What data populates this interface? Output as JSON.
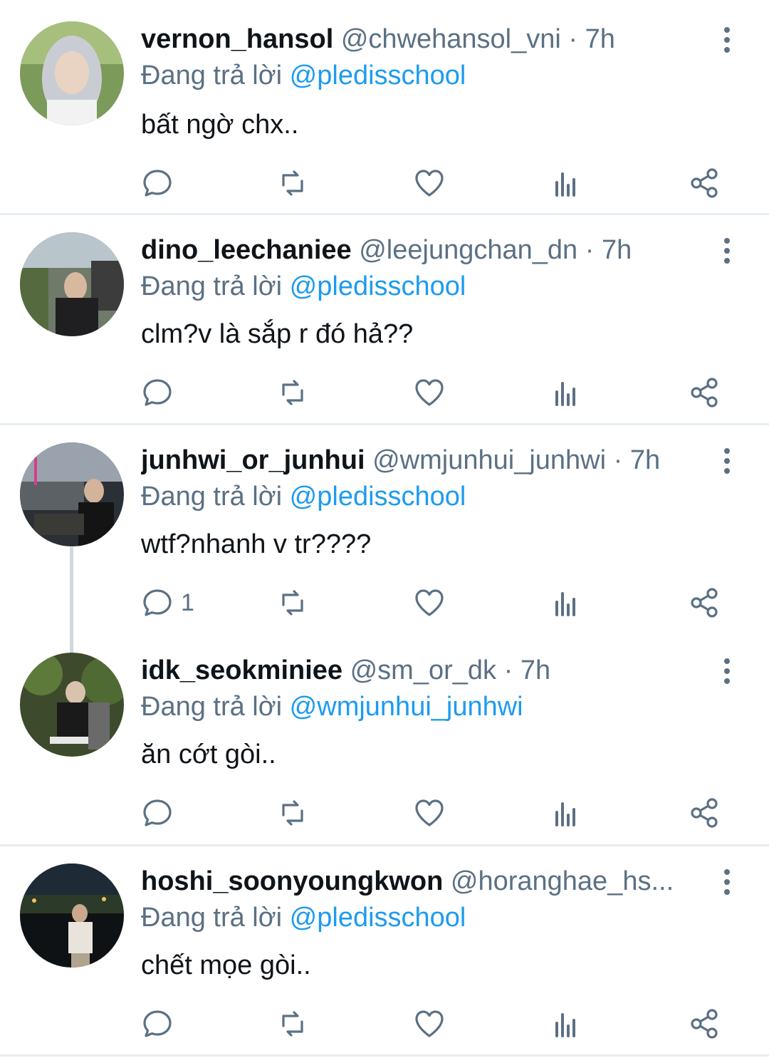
{
  "reply_prefix": "Đang trả lời",
  "colors": {
    "accent": "#1d9bf0",
    "secondary_text": "#5b7083",
    "divider": "#e6ecf0",
    "thread_line": "#cfd9de"
  },
  "tweets": [
    {
      "name": "vernon_hansol",
      "handle": "@chwehansol_vni",
      "separator": "·",
      "time": "7h",
      "reply_to": "@pledisschool",
      "text": "bất ngờ chx..",
      "reply_count": ""
    },
    {
      "name": "dino_leechaniee",
      "handle": "@leejungchan_dn",
      "separator": "·",
      "time": "7h",
      "reply_to": "@pledisschool",
      "text": "clm?v là sắp r đó hả??",
      "reply_count": ""
    },
    {
      "name": "junhwi_or_junhui",
      "handle": "@wmjunhui_junhwi",
      "separator": "·",
      "time": "7h",
      "reply_to": "@pledisschool",
      "text": "wtf?nhanh v tr????",
      "reply_count": "1"
    },
    {
      "name": "idk_seokminiee",
      "handle": "@sm_or_dk",
      "separator": "·",
      "time": "7h",
      "reply_to": "@wmjunhui_junhwi",
      "text": "ăn cớt gòi..",
      "reply_count": ""
    },
    {
      "name": "hoshi_soonyoungkwon",
      "handle": "@horanghae_hs...",
      "separator": "",
      "time": "",
      "reply_to": "@pledisschool",
      "text": "chết mọe gòi..",
      "reply_count": ""
    }
  ],
  "icons": {
    "reply": "reply-icon",
    "retweet": "retweet-icon",
    "like": "heart-icon",
    "views": "analytics-icon",
    "share": "share-icon",
    "more": "more-vertical-icon"
  }
}
